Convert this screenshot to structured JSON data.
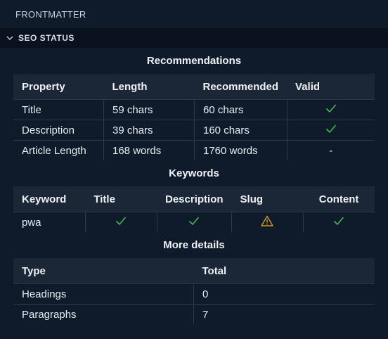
{
  "panel_title": "FRONTMATTER",
  "section": {
    "title": "SEO STATUS",
    "icon": "chevron-down-icon"
  },
  "recommendations": {
    "title": "Recommendations",
    "headers": [
      "Property",
      "Length",
      "Recommended",
      "Valid"
    ],
    "rows": [
      {
        "property": "Title",
        "length": "59 chars",
        "recommended": "60 chars",
        "valid": "check"
      },
      {
        "property": "Description",
        "length": "39 chars",
        "recommended": "160 chars",
        "valid": "check"
      },
      {
        "property": "Article Length",
        "length": "168 words",
        "recommended": "1760 words",
        "valid": "-"
      }
    ]
  },
  "keywords": {
    "title": "Keywords",
    "headers": [
      "Keyword",
      "Title",
      "Description",
      "Slug",
      "Content"
    ],
    "rows": [
      {
        "keyword": "pwa",
        "title": "check",
        "description": "check",
        "slug": "warning",
        "content": "check"
      }
    ]
  },
  "details": {
    "title": "More details",
    "headers": [
      "Type",
      "Total"
    ],
    "rows": [
      {
        "type": "Headings",
        "total": "0"
      },
      {
        "type": "Paragraphs",
        "total": "7"
      }
    ]
  },
  "colors": {
    "check": "#3fb950",
    "warning": "#d29922"
  }
}
